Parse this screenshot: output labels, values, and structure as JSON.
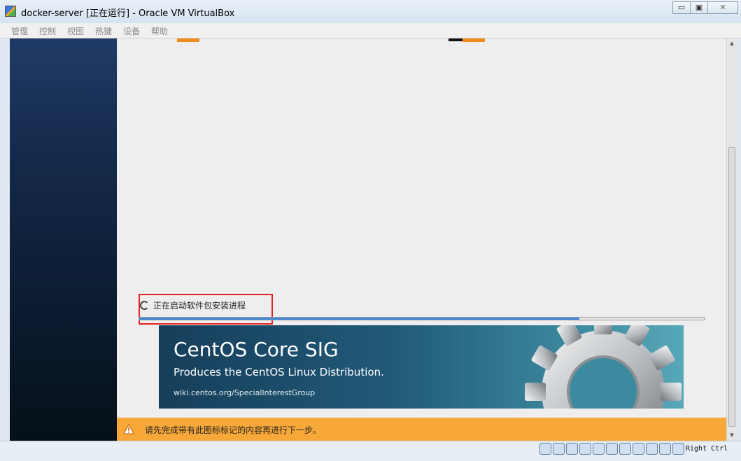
{
  "window": {
    "title": "docker-server [正在运行] - Oracle VM VirtualBox",
    "minimize_glyph": "▭",
    "restore_glyph": "▣",
    "close_glyph": "✕"
  },
  "menu": [
    "管理",
    "控制",
    "视图",
    "热键",
    "设备",
    "帮助"
  ],
  "installer": {
    "status_text": "正在启动软件包安装进程",
    "progress": 0.78,
    "banner": {
      "title": "CentOS Core SIG",
      "subtitle": "Produces the CentOS Linux Distribution.",
      "link": "wiki.centos.org/SpecialInterestGroup"
    },
    "warning": "请先完成带有此图标标记的内容再进行下一步。"
  },
  "statusbar": {
    "icons": [
      "hard-disk-icon",
      "optical-drive-icon",
      "audio-icon",
      "network-icon",
      "usb-icon",
      "shared-folders-icon",
      "display-icon",
      "video-capture-icon",
      "cpu-icon",
      "mouse-integration-icon",
      "keyboard-capture-icon"
    ],
    "host_key": "Right Ctrl"
  },
  "colors": {
    "accent_orange": "#f08a1c",
    "warning_bar": "#f8a838",
    "progress_fill": "#3c87d7",
    "highlight_box": "#e52222"
  }
}
